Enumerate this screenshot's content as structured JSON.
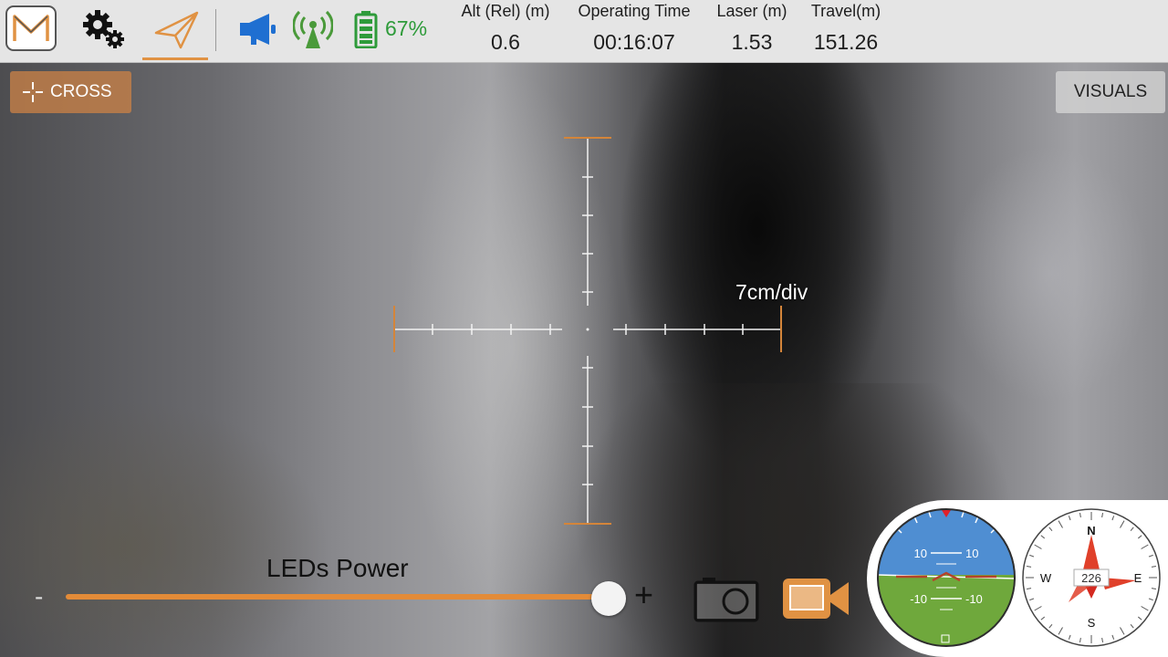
{
  "app": {
    "accent_color": "#e09243"
  },
  "topbar": {
    "icons": [
      "logo-icon",
      "gear-icon",
      "paper-plane-icon",
      "megaphone-icon",
      "signal-icon",
      "battery-icon"
    ],
    "battery_percent": "67%",
    "battery_color": "#2e9b3a",
    "telemetry": [
      {
        "label": "Alt (Rel) (m)",
        "value": "0.6"
      },
      {
        "label": "Operating Time",
        "value": "00:16:07"
      },
      {
        "label": "Laser (m)",
        "value": "1.53"
      },
      {
        "label": "Travel(m)",
        "value": "151.26"
      }
    ]
  },
  "overlay": {
    "cross_label": "CROSS",
    "visuals_label": "VISUALS",
    "scale_text": "7cm/div",
    "reticle_color": "#d4853a"
  },
  "controls": {
    "leds_label": "LEDs Power",
    "minus": "-",
    "plus": "+",
    "leds_level_fraction": 0.98
  },
  "attitude": {
    "pitch_top": [
      "10",
      "10"
    ],
    "pitch_bottom": [
      "-10",
      "-10"
    ],
    "sky_color": "#4f8ed2",
    "ground_color": "#6fa83c"
  },
  "compass": {
    "north": "N",
    "east": "E",
    "south": "S",
    "west": "W",
    "heading": "226"
  }
}
